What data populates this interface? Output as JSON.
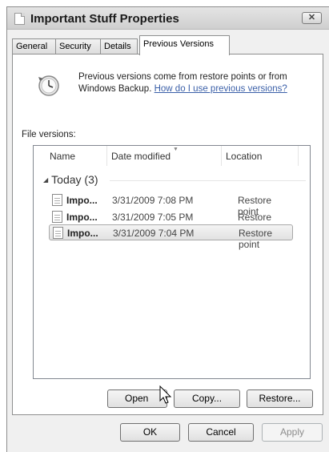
{
  "window": {
    "title": "Important Stuff Properties",
    "close_label": "✕"
  },
  "tabs": [
    {
      "label": "General"
    },
    {
      "label": "Security"
    },
    {
      "label": "Details"
    },
    {
      "label": "Previous Versions"
    }
  ],
  "info": {
    "text": "Previous versions come from restore points or from Windows Backup.",
    "link": "How do I use previous versions?"
  },
  "file_versions_label": "File versions:",
  "list": {
    "columns": [
      "Name",
      "Date modified",
      "Location"
    ],
    "group": "Today (3)",
    "rows": [
      {
        "name": "Impo...",
        "date": "3/31/2009 7:08 PM",
        "location": "Restore point"
      },
      {
        "name": "Impo...",
        "date": "3/31/2009 7:05 PM",
        "location": "Restore point"
      },
      {
        "name": "Impo...",
        "date": "3/31/2009 7:04 PM",
        "location": "Restore point"
      }
    ]
  },
  "actions": {
    "open": "Open",
    "copy": "Copy...",
    "restore": "Restore..."
  },
  "dialog_buttons": {
    "ok": "OK",
    "cancel": "Cancel",
    "apply": "Apply"
  }
}
